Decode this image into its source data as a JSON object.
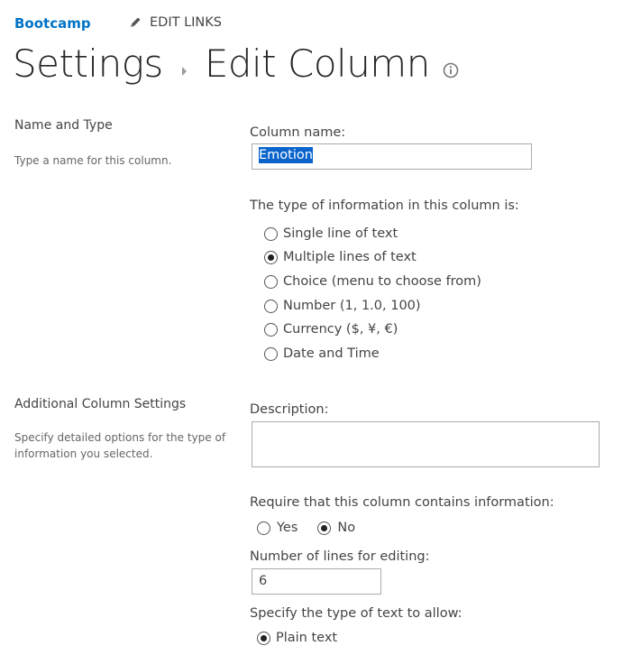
{
  "header": {
    "site_name": "Bootcamp",
    "edit_links_label": "EDIT LINKS"
  },
  "title": {
    "parent": "Settings",
    "current": "Edit Column"
  },
  "name_and_type": {
    "section_title": "Name and Type",
    "section_description": "Type a name for this column.",
    "column_name_label": "Column name:",
    "column_name_value": "Emotion",
    "type_label": "The type of information in this column is:",
    "types": [
      {
        "label": "Single line of text",
        "checked": false
      },
      {
        "label": "Multiple lines of text",
        "checked": true
      },
      {
        "label": "Choice (menu to choose from)",
        "checked": false
      },
      {
        "label": "Number (1, 1.0, 100)",
        "checked": false
      },
      {
        "label": "Currency ($, ¥, €)",
        "checked": false
      },
      {
        "label": "Date and Time",
        "checked": false
      }
    ]
  },
  "additional": {
    "section_title": "Additional Column Settings",
    "section_description": "Specify detailed options for the type of information you selected.",
    "description_label": "Description:",
    "description_value": "",
    "require_label": "Require that this column contains information:",
    "require_yes": "Yes",
    "require_no": "No",
    "require_selected": "No",
    "lines_label": "Number of lines for editing:",
    "lines_value": "6",
    "text_type_label": "Specify the type of text to allow:",
    "text_type_option": "Plain text"
  }
}
